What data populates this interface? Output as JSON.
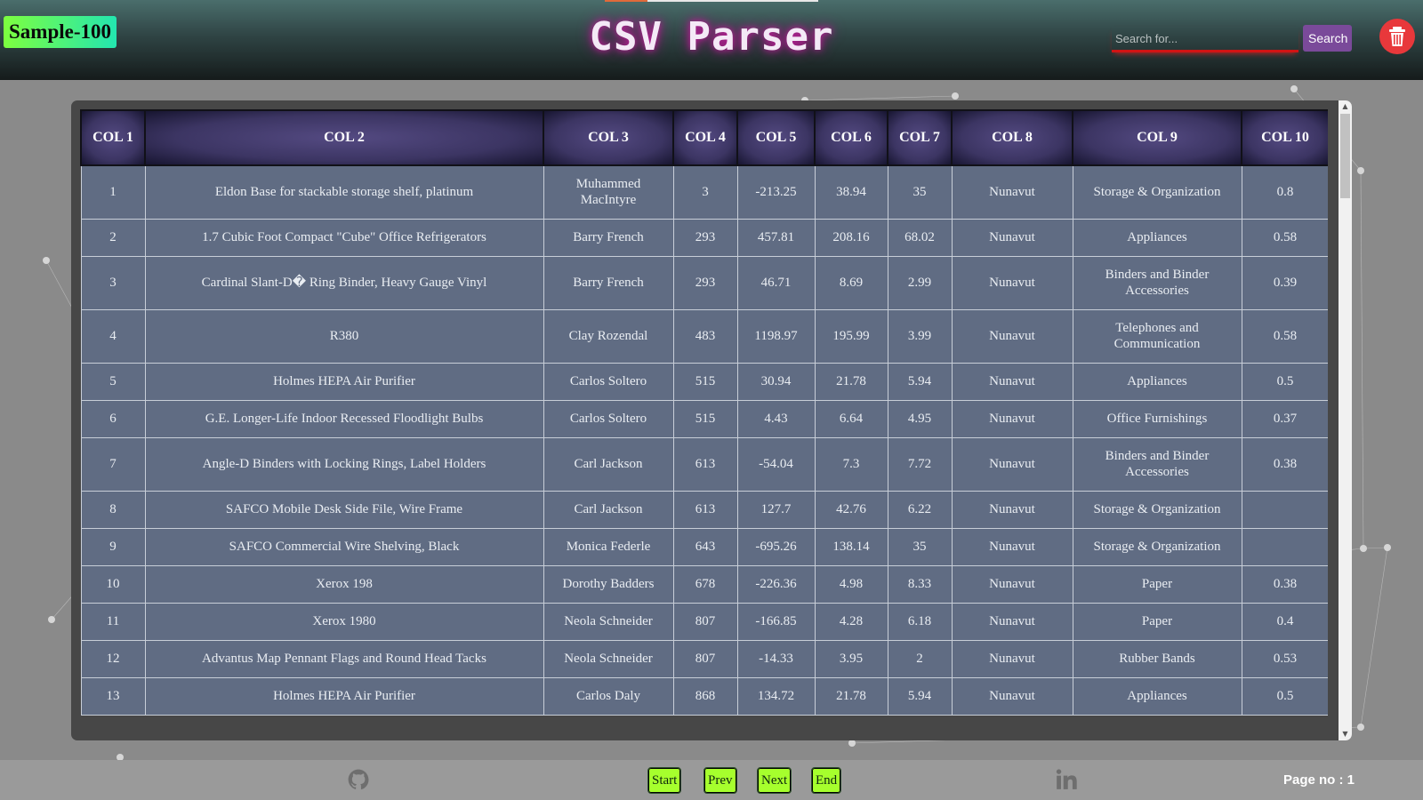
{
  "header": {
    "sample_badge": "Sample-100",
    "title": "CSV Parser",
    "search_placeholder": "Search for...",
    "search_button": "Search",
    "delete_icon": "trash-icon"
  },
  "table": {
    "columns": [
      "COL 1",
      "COL 2",
      "COL 3",
      "COL 4",
      "COL 5",
      "COL 6",
      "COL 7",
      "COL 8",
      "COL 9",
      "COL 10"
    ],
    "rows": [
      [
        "1",
        "Eldon Base for stackable storage shelf, platinum",
        "Muhammed MacIntyre",
        "3",
        "-213.25",
        "38.94",
        "35",
        "Nunavut",
        "Storage & Organization",
        "0.8"
      ],
      [
        "2",
        "1.7 Cubic Foot Compact \"Cube\" Office Refrigerators",
        "Barry French",
        "293",
        "457.81",
        "208.16",
        "68.02",
        "Nunavut",
        "Appliances",
        "0.58"
      ],
      [
        "3",
        "Cardinal Slant-D� Ring Binder, Heavy Gauge Vinyl",
        "Barry French",
        "293",
        "46.71",
        "8.69",
        "2.99",
        "Nunavut",
        "Binders and Binder Accessories",
        "0.39"
      ],
      [
        "4",
        "R380",
        "Clay Rozendal",
        "483",
        "1198.97",
        "195.99",
        "3.99",
        "Nunavut",
        "Telephones and Communication",
        "0.58"
      ],
      [
        "5",
        "Holmes HEPA Air Purifier",
        "Carlos Soltero",
        "515",
        "30.94",
        "21.78",
        "5.94",
        "Nunavut",
        "Appliances",
        "0.5"
      ],
      [
        "6",
        "G.E. Longer-Life Indoor Recessed Floodlight Bulbs",
        "Carlos Soltero",
        "515",
        "4.43",
        "6.64",
        "4.95",
        "Nunavut",
        "Office Furnishings",
        "0.37"
      ],
      [
        "7",
        "Angle-D Binders with Locking Rings, Label Holders",
        "Carl Jackson",
        "613",
        "-54.04",
        "7.3",
        "7.72",
        "Nunavut",
        "Binders and Binder Accessories",
        "0.38"
      ],
      [
        "8",
        "SAFCO Mobile Desk Side File, Wire Frame",
        "Carl Jackson",
        "613",
        "127.7",
        "42.76",
        "6.22",
        "Nunavut",
        "Storage & Organization",
        ""
      ],
      [
        "9",
        "SAFCO Commercial Wire Shelving, Black",
        "Monica Federle",
        "643",
        "-695.26",
        "138.14",
        "35",
        "Nunavut",
        "Storage & Organization",
        ""
      ],
      [
        "10",
        "Xerox 198",
        "Dorothy Badders",
        "678",
        "-226.36",
        "4.98",
        "8.33",
        "Nunavut",
        "Paper",
        "0.38"
      ],
      [
        "11",
        "Xerox 1980",
        "Neola Schneider",
        "807",
        "-166.85",
        "4.28",
        "6.18",
        "Nunavut",
        "Paper",
        "0.4"
      ],
      [
        "12",
        "Advantus Map Pennant Flags and Round Head Tacks",
        "Neola Schneider",
        "807",
        "-14.33",
        "3.95",
        "2",
        "Nunavut",
        "Rubber Bands",
        "0.53"
      ],
      [
        "13",
        "Holmes HEPA Air Purifier",
        "Carlos Daly",
        "868",
        "134.72",
        "21.78",
        "5.94",
        "Nunavut",
        "Appliances",
        "0.5"
      ]
    ]
  },
  "footer": {
    "github_icon": "github-icon",
    "linkedin_icon": "linkedin-icon",
    "buttons": {
      "start": "Start",
      "prev": "Prev",
      "next": "Next",
      "end": "End"
    },
    "page_label": "Page no : 1"
  },
  "colors": {
    "accent_purple": "#7a4a9a",
    "delete_red": "#e8383b",
    "pager_green": "#a6ff2d",
    "title_glow": "#c21e9c"
  }
}
